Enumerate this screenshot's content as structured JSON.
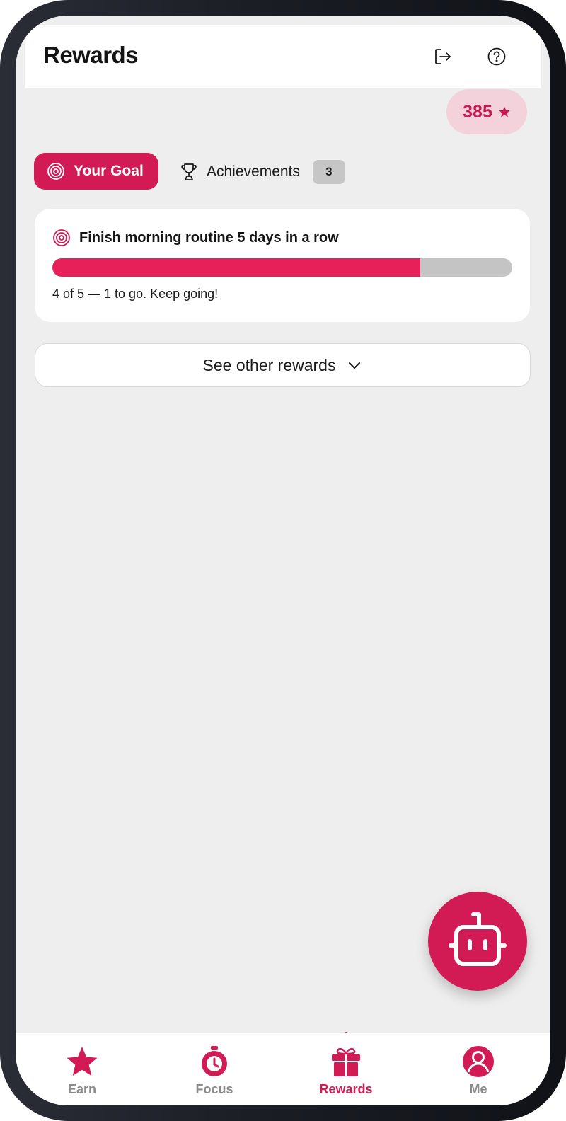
{
  "header": {
    "title": "Rewards",
    "logout_icon": "logout-icon",
    "help_icon": "help-circle-icon"
  },
  "points": {
    "value": "385",
    "icon": "star-icon"
  },
  "tabs": {
    "goal": {
      "label": "Your Goal",
      "icon": "target-icon",
      "active": true
    },
    "achievements": {
      "label": "Achievements",
      "icon": "trophy-icon",
      "badge": "3",
      "active": false
    }
  },
  "goal_card": {
    "title": "Finish morning routine 5 days in a row",
    "icon": "target-icon",
    "progress": {
      "current": 4,
      "total": 5,
      "fraction": 0.8
    },
    "status_text": "4 of 5 — 1 to go. Keep going!"
  },
  "see_other": {
    "label": "See other rewards",
    "icon": "chevron-down-icon"
  },
  "fab": {
    "icon": "robot-icon"
  },
  "bottom_nav": {
    "items": [
      {
        "label": "Earn",
        "icon": "star-icon",
        "active": false
      },
      {
        "label": "Focus",
        "icon": "stopwatch-icon",
        "active": false
      },
      {
        "label": "Rewards",
        "icon": "gift-icon",
        "active": true
      },
      {
        "label": "Me",
        "icon": "user-icon",
        "active": false
      }
    ]
  },
  "colors": {
    "accent": "#d21a55",
    "progress_fill": "#e8205a",
    "progress_track": "#c4c4c4",
    "background": "#eeeeee",
    "points_pill": "#f4d2dc"
  }
}
